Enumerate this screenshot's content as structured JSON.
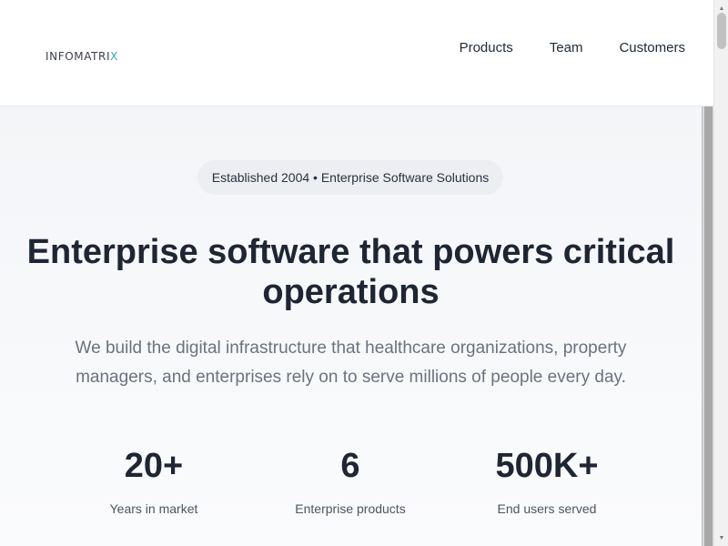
{
  "header": {
    "logo_main": "INFOMATRI",
    "logo_accent": "X",
    "nav": [
      {
        "label": "Products"
      },
      {
        "label": "Team"
      },
      {
        "label": "Customers"
      }
    ]
  },
  "hero": {
    "badge": "Established 2004 • Enterprise Software Solutions",
    "headline": "Enterprise software that powers critical operations",
    "subhead": "We build the digital infrastructure that healthcare organizations, property managers, and enterprises rely on to serve millions of people every day.",
    "stats": [
      {
        "value": "20+",
        "label": "Years in market"
      },
      {
        "value": "6",
        "label": "Enterprise products"
      },
      {
        "value": "500K+",
        "label": "End users served"
      }
    ]
  },
  "scrollbar": {
    "up_icon": "▲",
    "down_icon": "▼"
  },
  "colors": {
    "accent": "#3ba3b8",
    "text_dark": "#1e2533",
    "text_muted": "#6b7280",
    "badge_bg": "#eceef2"
  }
}
